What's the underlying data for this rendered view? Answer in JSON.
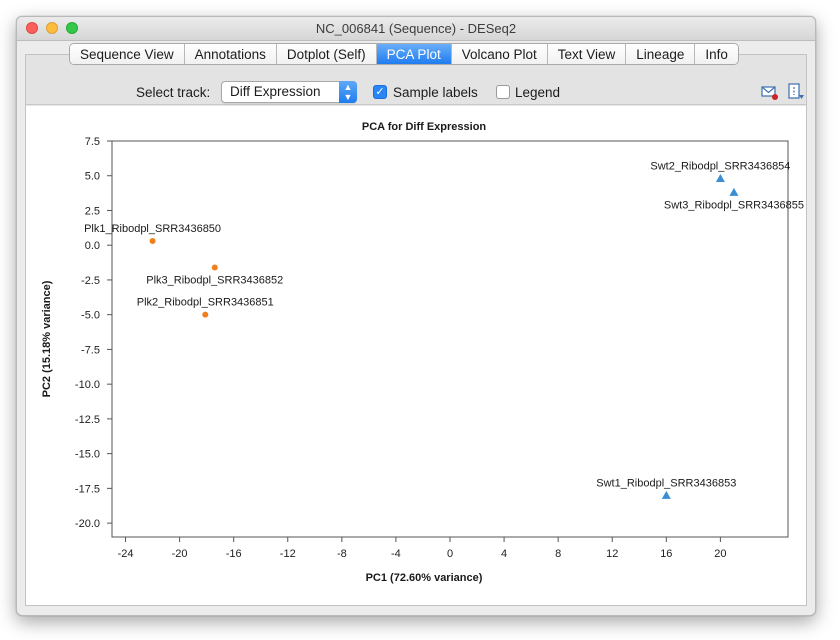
{
  "window": {
    "title": "NC_006841 (Sequence) - DESeq2"
  },
  "tabs": [
    {
      "label": "Sequence View",
      "active": false
    },
    {
      "label": "Annotations",
      "active": false
    },
    {
      "label": "Dotplot (Self)",
      "active": false
    },
    {
      "label": "PCA Plot",
      "active": true
    },
    {
      "label": "Volcano Plot",
      "active": false
    },
    {
      "label": "Text View",
      "active": false
    },
    {
      "label": "Lineage",
      "active": false
    },
    {
      "label": "Info",
      "active": false
    }
  ],
  "toolbar": {
    "select_track_label": "Select track:",
    "select_track_value": "Diff Expression",
    "sample_labels_label": "Sample labels",
    "sample_labels_checked": true,
    "legend_label": "Legend",
    "legend_checked": false,
    "icons": [
      "email-icon",
      "export-icon"
    ]
  },
  "chart_data": {
    "type": "scatter",
    "title": "PCA for Diff Expression",
    "xlabel": "PC1 (72.60% variance)",
    "ylabel": "PC2 (15.18% variance)",
    "xlim": [
      -25,
      25
    ],
    "ylim": [
      -21,
      7.5
    ],
    "xticks": [
      -24,
      -20,
      -16,
      -12,
      -8,
      -4,
      0,
      4,
      8,
      12,
      16,
      20
    ],
    "yticks": [
      7.5,
      5.0,
      2.5,
      0.0,
      -2.5,
      -5.0,
      -7.5,
      -10.0,
      -12.5,
      -15.0,
      -17.5,
      -20.0
    ],
    "colors": {
      "orange": "#f07f1c",
      "blue": "#3a8fd4"
    },
    "series": [
      {
        "marker": "circle",
        "color": "#f07f1c",
        "points": [
          {
            "x": -22.0,
            "y": 0.3,
            "label": "Plk1_Ribodpl_SRR3436850",
            "label_pos": "above"
          },
          {
            "x": -17.4,
            "y": -1.6,
            "label": "Plk3_Ribodpl_SRR3436852",
            "label_pos": "below"
          },
          {
            "x": -18.1,
            "y": -5.0,
            "label": "Plk2_Ribodpl_SRR3436851",
            "label_pos": "above"
          }
        ]
      },
      {
        "marker": "triangle",
        "color": "#3a8fd4",
        "points": [
          {
            "x": 20.0,
            "y": 4.8,
            "label": "Swt2_Ribodpl_SRR3436854",
            "label_pos": "above"
          },
          {
            "x": 21.0,
            "y": 3.8,
            "label": "Swt3_Ribodpl_SRR3436855",
            "label_pos": "below"
          },
          {
            "x": 16.0,
            "y": -18.0,
            "label": "Swt1_Ribodpl_SRR3436853",
            "label_pos": "above"
          }
        ]
      }
    ]
  }
}
